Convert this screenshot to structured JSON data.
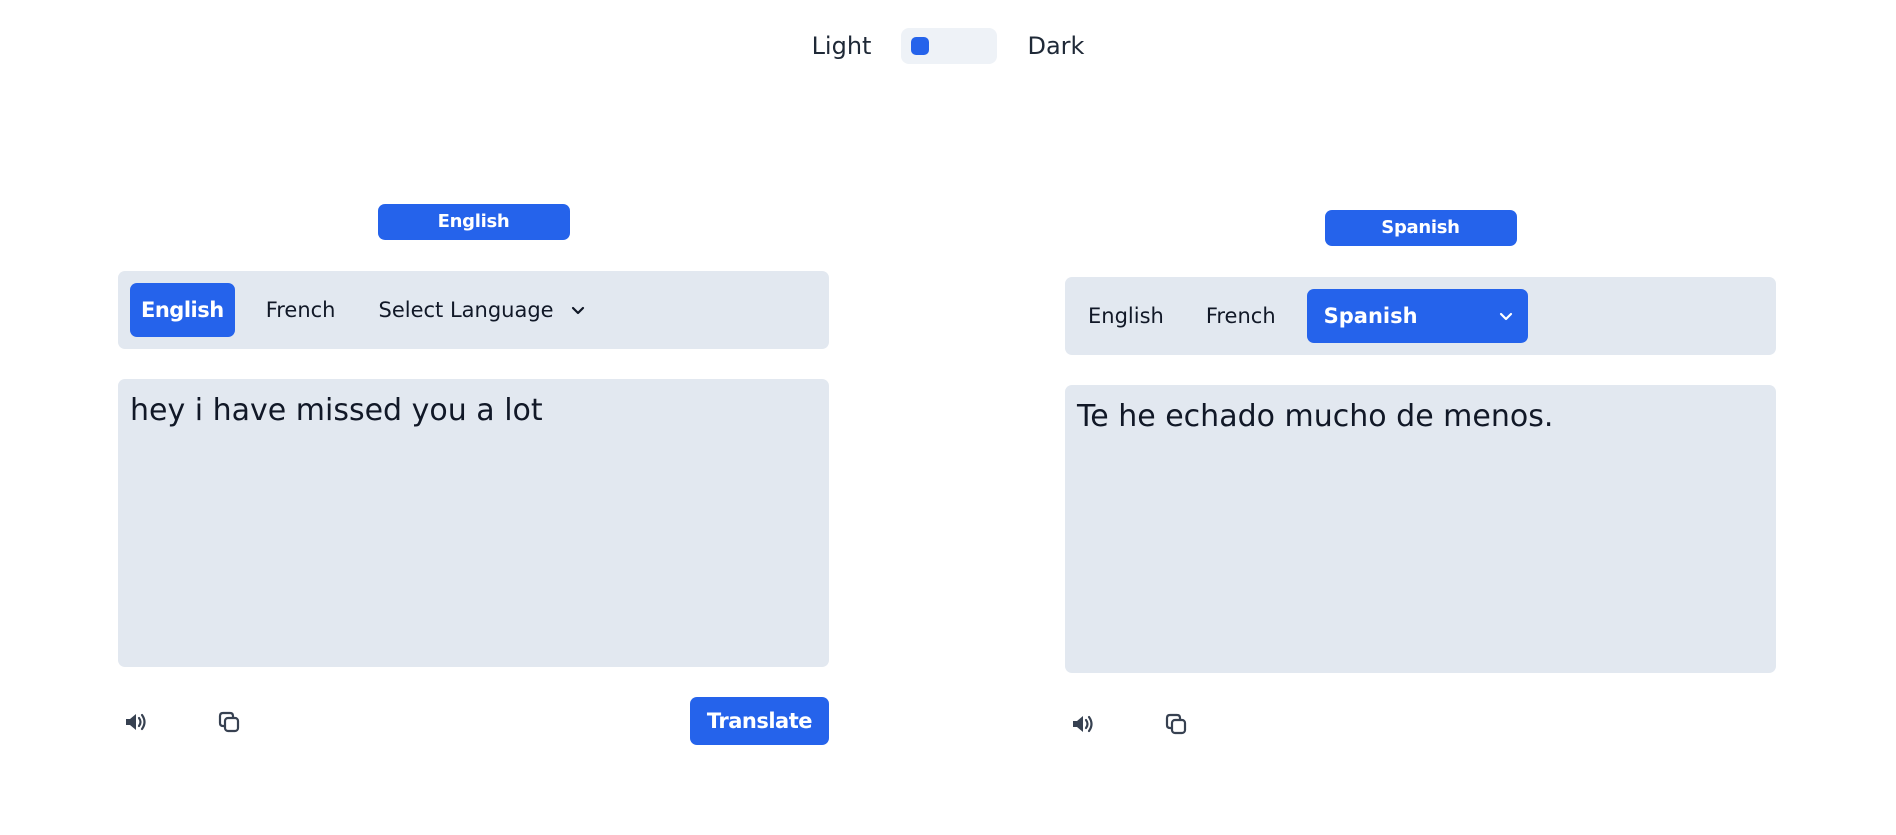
{
  "theme_toggle": {
    "light_label": "Light",
    "dark_label": "Dark"
  },
  "source_panel": {
    "badge": "English",
    "tabs": [
      {
        "label": "English",
        "active": true
      },
      {
        "label": "French",
        "active": false
      }
    ],
    "select": {
      "label": "Select Language",
      "active": false
    },
    "text": "hey i have missed you a lot",
    "translate_label": "Translate"
  },
  "target_panel": {
    "badge": "Spanish",
    "tabs": [
      {
        "label": "English",
        "active": false
      },
      {
        "label": "French",
        "active": false
      }
    ],
    "select": {
      "label": "Spanish",
      "active": true
    },
    "text": "Te he echado mucho de menos."
  },
  "colors": {
    "accent": "#2563eb",
    "panel_bg": "#e2e8f0",
    "toggle_bg": "#eef2f7"
  },
  "icons": {
    "speaker": "speaker-icon",
    "copy": "copy-icon",
    "chevron": "chevron-down-icon"
  }
}
